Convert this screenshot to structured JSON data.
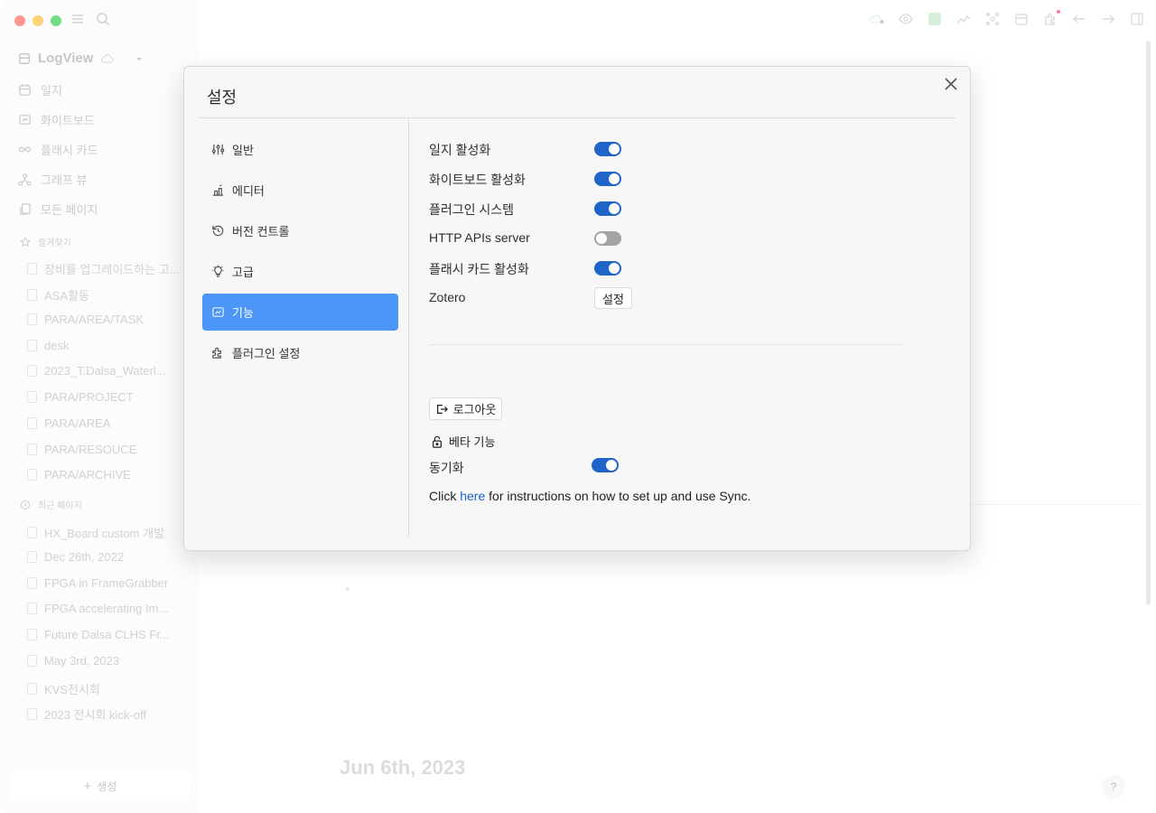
{
  "sidebar": {
    "graph_name": "LogView",
    "nav": [
      {
        "label": "일지",
        "icon": "calendar-icon"
      },
      {
        "label": "화이트보드",
        "icon": "whiteboard-icon"
      },
      {
        "label": "플래시 카드",
        "icon": "infinity-icon"
      },
      {
        "label": "그래프 뷰",
        "icon": "graph-icon"
      },
      {
        "label": "모든 페이지",
        "icon": "pages-icon"
      }
    ],
    "favorites_title": "즐겨찾기",
    "favorites": [
      "장비를 업그레이드하는 고...",
      "ASA활동",
      "PARA/AREA/TASK",
      "desk",
      "2023_T.Dalsa_Waterl...",
      "PARA/PROJECT",
      "PARA/AREA",
      "PARA/RESOUCE",
      "PARA/ARCHIVE"
    ],
    "recent_title": "최근 페이지",
    "recent": [
      "HX_Board custom 개발",
      "Dec 26th, 2022",
      "FPGA in FrameGrabber",
      "FPGA accelerating Im...",
      "Future Dalsa CLHS Fr...",
      "May 3rd, 2023",
      "KVS전시회",
      "2023 전시회 kick-off"
    ],
    "new_label": "생성"
  },
  "main": {
    "journal_date": "Jun 6th, 2023",
    "help_label": "?"
  },
  "settings": {
    "title": "설정",
    "menu": [
      {
        "label": "일반",
        "icon": "sliders-icon",
        "active": false
      },
      {
        "label": "에디터",
        "icon": "editor-icon",
        "active": false
      },
      {
        "label": "버전 컨트롤",
        "icon": "history-icon",
        "active": false
      },
      {
        "label": "고급",
        "icon": "bulb-icon",
        "active": false
      },
      {
        "label": "기능",
        "icon": "features-icon",
        "active": true
      },
      {
        "label": "플러그인 설정",
        "icon": "puzzle-icon",
        "active": false
      }
    ],
    "rows": [
      {
        "label": "일지 활성화",
        "on": true
      },
      {
        "label": "화이트보드 활성화",
        "on": true
      },
      {
        "label": "플러그인 시스템",
        "on": true
      },
      {
        "label": "HTTP APIs server",
        "on": false
      },
      {
        "label": "플래시 카드 활성화",
        "on": true
      }
    ],
    "zotero_label": "Zotero",
    "zotero_button": "설정",
    "logout_button": "로그아웃",
    "beta_label": "베타 기능",
    "sync_label": "동기화",
    "sync_on": true,
    "sync_info_prefix": "Click ",
    "sync_info_link": "here",
    "sync_info_suffix": " for instructions on how to set up and use Sync."
  }
}
